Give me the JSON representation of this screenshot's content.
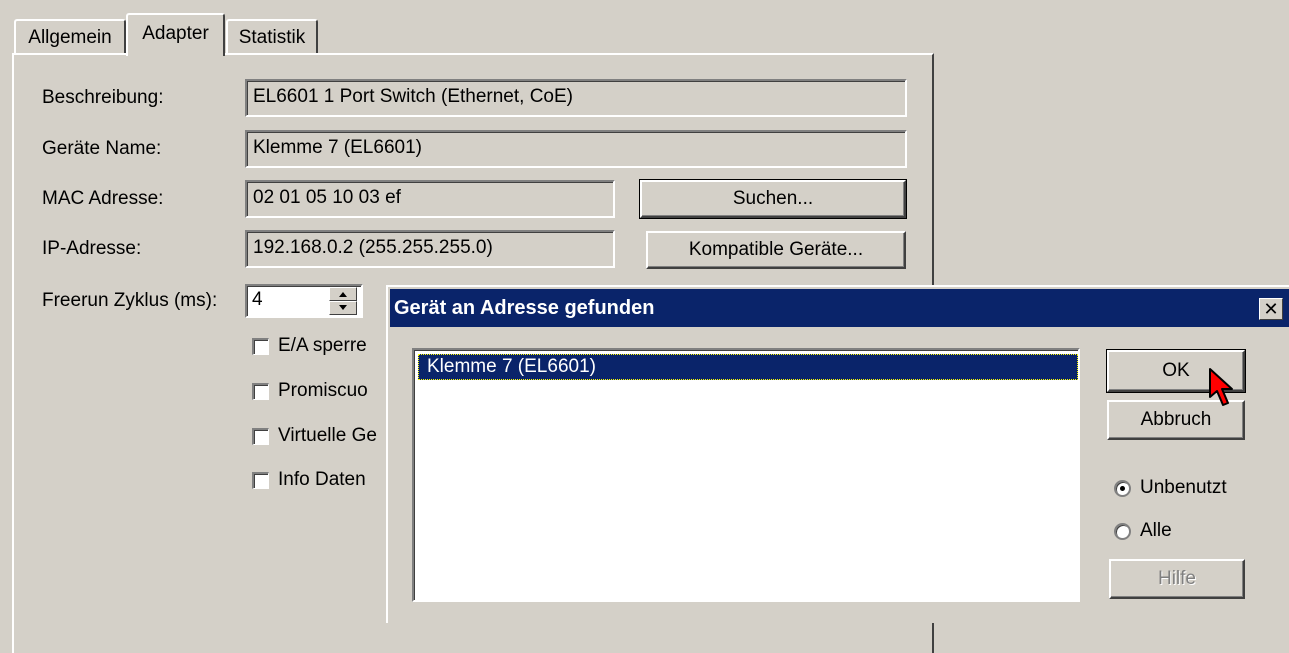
{
  "tabs": [
    {
      "label": "Allgemein"
    },
    {
      "label": "Adapter"
    },
    {
      "label": "Statistik"
    }
  ],
  "active_tab": "Adapter",
  "form": {
    "beschreibung": {
      "label": "Beschreibung:",
      "value": "EL6601 1 Port Switch (Ethernet, CoE)"
    },
    "geraete_name": {
      "label": "Geräte Name:",
      "value": "Klemme 7 (EL6601)"
    },
    "mac": {
      "label": "MAC Adresse:",
      "value": "02 01 05 10 03 ef"
    },
    "ip": {
      "label": "IP-Adresse:",
      "value": "192.168.0.2 (255.255.255.0)"
    },
    "freerun": {
      "label": "Freerun Zyklus (ms):",
      "value": "4"
    },
    "suchen_button": "Suchen...",
    "kompatible_button": "Kompatible Geräte...",
    "checkboxes": [
      {
        "label": "E/A sperre",
        "checked": false
      },
      {
        "label": "Promiscuo",
        "checked": false
      },
      {
        "label": "Virtuelle Ge",
        "checked": false
      },
      {
        "label": "Info Daten",
        "checked": false
      }
    ]
  },
  "dialog": {
    "title": "Gerät an Adresse gefunden",
    "close_glyph": "✕",
    "list_items": [
      "Klemme 7 (EL6601)"
    ],
    "selected_index": 0,
    "ok_button": "OK",
    "abbruch_button": "Abbruch",
    "hilfe_button": "Hilfe",
    "radio_options": [
      {
        "label": "Unbenutzt",
        "checked": true
      },
      {
        "label": "Alle",
        "checked": false
      }
    ]
  },
  "icons": {
    "spin_up": "up-arrow-icon",
    "spin_down": "down-arrow-icon",
    "cursor": "mouse-pointer-icon",
    "cursor_color": "#ff0000"
  },
  "colors": {
    "face": "#d4d0c8",
    "titlebar": "#0a246a",
    "selection": "#0a246a"
  }
}
